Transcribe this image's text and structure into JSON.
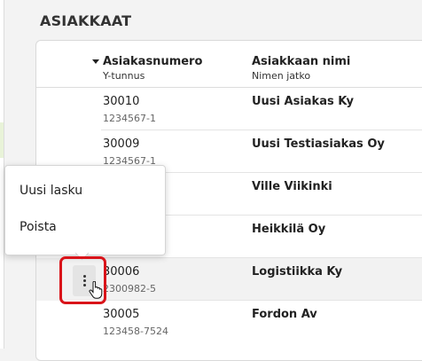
{
  "page": {
    "title": "ASIAKKAAT"
  },
  "table": {
    "columns": [
      {
        "label": "Asiakasnumero",
        "sublabel": "Y-tunnus",
        "sort_icon": "sort-desc-icon"
      },
      {
        "label": "Asiakkaan nimi",
        "sublabel": "Nimen jatko"
      }
    ],
    "rows": [
      {
        "number": "30010",
        "ytunnus": "1234567-1",
        "name": "Uusi Asiakas Ky"
      },
      {
        "number": "30009",
        "ytunnus": "1234567-1",
        "name": "Uusi Testiasiakas Oy"
      },
      {
        "number": "",
        "ytunnus": "",
        "name": "Ville Viikinki"
      },
      {
        "number": "",
        "ytunnus": "",
        "name": "Heikkilä Oy"
      },
      {
        "number": "30006",
        "ytunnus": "2300982-5",
        "name": "Logistiikka Ky"
      },
      {
        "number": "30005",
        "ytunnus": "123458-7524",
        "name": "Fordon Av"
      }
    ]
  },
  "context_menu": {
    "items": [
      {
        "label": "Uusi lasku"
      },
      {
        "label": "Poista"
      }
    ]
  },
  "row_actions": {
    "icon": "kebab-menu-icon",
    "highlight_color": "#d9141a"
  }
}
